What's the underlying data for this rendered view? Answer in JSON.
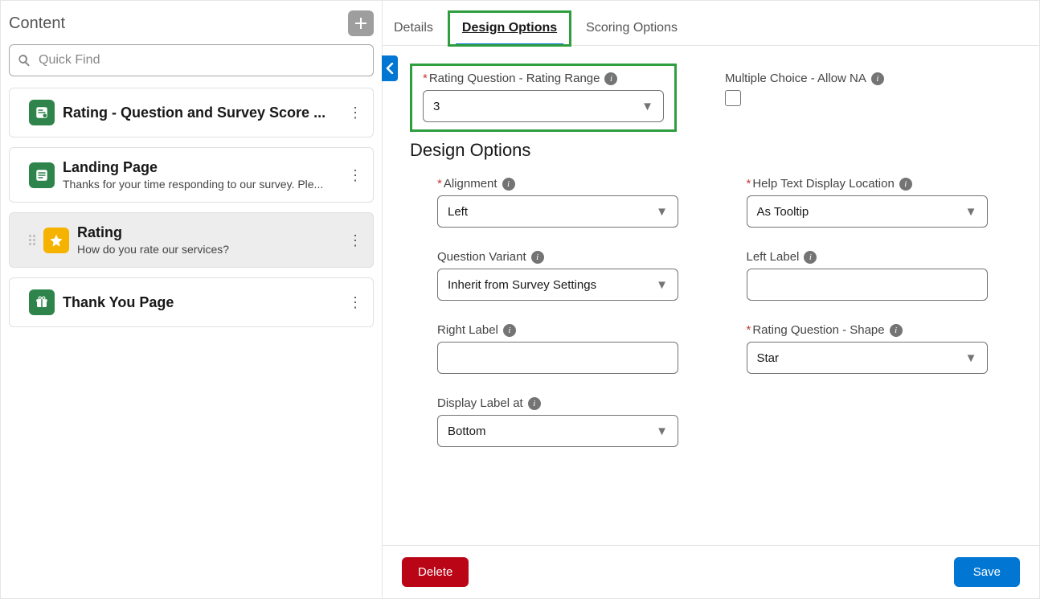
{
  "sidebar": {
    "title": "Content",
    "search_placeholder": "Quick Find",
    "items": [
      {
        "title": "Rating - Question and Survey Score ...",
        "sub": "",
        "icon": "form-icon",
        "color": "green",
        "selected": false
      },
      {
        "title": "Landing Page",
        "sub": "Thanks for your time responding to our survey. Ple...",
        "icon": "page-icon",
        "color": "green",
        "selected": false
      },
      {
        "title": "Rating",
        "sub": "How do you rate our services?",
        "icon": "star-icon",
        "color": "yellow",
        "selected": true
      },
      {
        "title": "Thank You Page",
        "sub": "",
        "icon": "gift-icon",
        "color": "green",
        "selected": false
      }
    ]
  },
  "tabs": {
    "details": "Details",
    "design": "Design Options",
    "scoring": "Scoring Options",
    "active": "design"
  },
  "form": {
    "rating_range": {
      "label": "Rating Question - Rating Range",
      "value": "3",
      "required": true
    },
    "allow_na": {
      "label": "Multiple Choice - Allow NA",
      "checked": false
    },
    "section_heading": "Design Options",
    "alignment": {
      "label": "Alignment",
      "value": "Left",
      "required": true
    },
    "help_loc": {
      "label": "Help Text Display Location",
      "value": "As Tooltip",
      "required": true
    },
    "variant": {
      "label": "Question Variant",
      "value": "Inherit from Survey Settings",
      "required": false
    },
    "left_label": {
      "label": "Left Label",
      "value": "",
      "required": false
    },
    "right_label": {
      "label": "Right Label",
      "value": "",
      "required": false
    },
    "shape": {
      "label": "Rating Question - Shape",
      "value": "Star",
      "required": true
    },
    "display_label_at": {
      "label": "Display Label at",
      "value": "Bottom",
      "required": false
    }
  },
  "buttons": {
    "delete": "Delete",
    "save": "Save"
  }
}
